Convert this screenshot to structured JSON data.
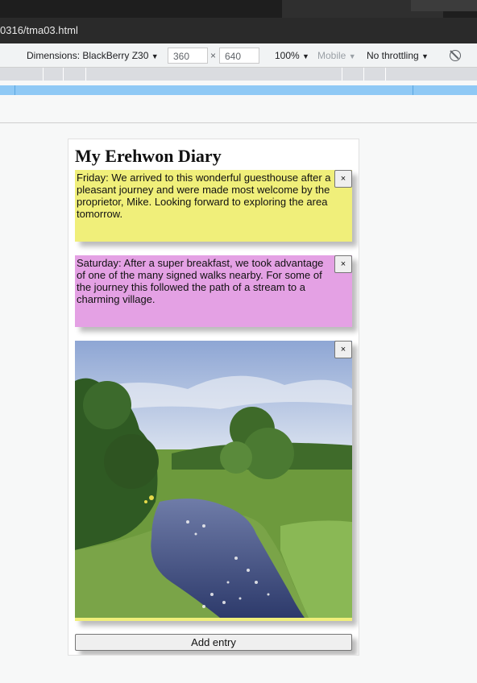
{
  "browser": {
    "url_fragment": "0316/tma03.html"
  },
  "devtools": {
    "dimensions_label": "Dimensions: BlackBerry Z30",
    "width": "360",
    "times": "×",
    "height": "640",
    "zoom": "100%",
    "mode": "Mobile",
    "throttling": "No throttling",
    "caret": "▼",
    "rotate_icon": "rotate-icon"
  },
  "diary": {
    "title": "My Erehwon Diary",
    "close_label": "×",
    "entries": [
      {
        "text": "Friday: We arrived to this wonderful guesthouse after a pleasant journey and were made most welcome by the proprietor, Mike. Looking forward to exploring the area tomorrow.",
        "color": "#f0ef7a"
      },
      {
        "text": "Saturday: After a super breakfast, we took advantage of one of the many signed walks nearby. For some of the journey this followed the path of a stream to a charming village.",
        "color": "#e4a1e4"
      },
      {
        "image": "stream-photo",
        "color": "#f0ef7a"
      }
    ],
    "add_button": "Add entry"
  }
}
